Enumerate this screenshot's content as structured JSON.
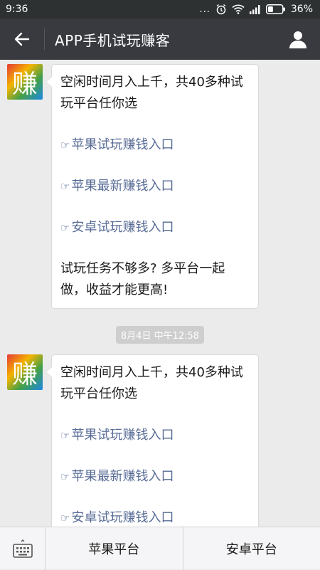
{
  "status_bar": {
    "time": "9:36",
    "dots": "...",
    "battery": "36%",
    "battery_level": 0.36
  },
  "header": {
    "title": "APP手机试玩赚客"
  },
  "avatar_char": "赚",
  "messages": [
    {
      "intro": "空闲时间月入上千，共40多种试玩平台任你选",
      "links": [
        {
          "hand": "☞",
          "text": "苹果试玩赚钱入口"
        },
        {
          "hand": "☞",
          "text": "苹果最新赚钱入口"
        },
        {
          "hand": "☞",
          "text": "安卓试玩赚钱入口"
        }
      ],
      "outro": "试玩任务不够多? 多平台一起做，收益才能更高!"
    },
    {
      "intro": "空闲时间月入上千，共40多种试玩平台任你选",
      "links": [
        {
          "hand": "☞",
          "text": "苹果试玩赚钱入口"
        },
        {
          "hand": "☞",
          "text": "苹果最新赚钱入口"
        },
        {
          "hand": "☞",
          "text": "安卓试玩赚钱入口"
        }
      ]
    }
  ],
  "timestamp": "8月4日 中午12:58",
  "bottom_menu": {
    "items": [
      "苹果平台",
      "安卓平台"
    ]
  },
  "colors": {
    "status_bar": "#2e3132",
    "title_bar": "#393a3f",
    "link": "#576b95",
    "background": "#ebebeb"
  }
}
